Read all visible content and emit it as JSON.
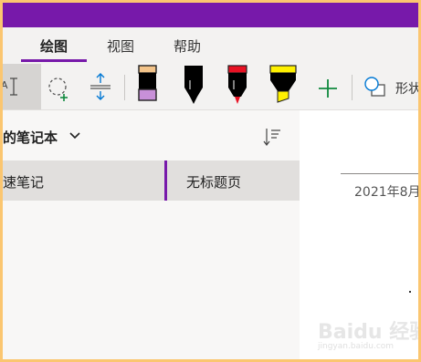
{
  "window": {
    "accent_color": "#7719aa",
    "frame_color": "#fbc670"
  },
  "tabs": [
    {
      "label": "绘图",
      "active": true
    },
    {
      "label": "视图",
      "active": false
    },
    {
      "label": "帮助",
      "active": false
    }
  ],
  "ribbon": {
    "tools": [
      {
        "icon": "text-select-icon",
        "selected": true
      },
      {
        "icon": "lasso-select-add-icon"
      },
      {
        "icon": "insert-space-icon"
      },
      {
        "icon": "pen-pink-icon",
        "color": "#c890d8"
      },
      {
        "icon": "pen-black-icon",
        "color": "#000000"
      },
      {
        "icon": "pen-red-icon",
        "color": "#e81123"
      },
      {
        "icon": "highlighter-yellow-icon",
        "color": "#fff100"
      },
      {
        "icon": "add-pen-icon",
        "color": "#10893e"
      },
      {
        "icon": "shapes-icon"
      }
    ],
    "shapes_label": "形状"
  },
  "notebook": {
    "title": "的笔记本"
  },
  "sections": [
    {
      "label": "速笔记",
      "selected": true
    }
  ],
  "pages": [
    {
      "label": "无标题页",
      "selected": true
    }
  ],
  "canvas": {
    "date": "2021年8月"
  },
  "watermark": {
    "text": "Baidu 经验",
    "url": "jingyan.baidu.com"
  }
}
